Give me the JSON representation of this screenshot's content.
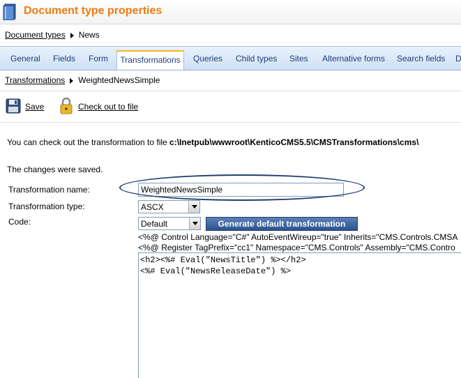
{
  "header": {
    "title": "Document type properties"
  },
  "breadcrumb_top": {
    "link": "Document types",
    "current": "News"
  },
  "tabs": [
    {
      "label": "General"
    },
    {
      "label": "Fields"
    },
    {
      "label": "Form"
    },
    {
      "label": "Transformations",
      "active": true
    },
    {
      "label": "Queries"
    },
    {
      "label": "Child types"
    },
    {
      "label": "Sites"
    },
    {
      "label": "Alternative forms"
    },
    {
      "label": "Search fields"
    },
    {
      "label": "D"
    }
  ],
  "breadcrumb_sub": {
    "link": "Transformations",
    "current": "WeightedNewsSimple"
  },
  "toolbar": {
    "save_label": "Save",
    "checkout_label": "Check out to file"
  },
  "info": {
    "prefix": "You can check out the transformation to file ",
    "path": "c:\\Inetpub\\wwwroot\\KenticoCMS5.5\\CMSTransformations\\cms\\"
  },
  "status": {
    "saved": "The changes were saved."
  },
  "form": {
    "name_label": "Transformation name:",
    "name_value": "WeightedNewsSimple",
    "type_label": "Transformation type:",
    "type_value": "ASCX",
    "code_label": "Code:",
    "code_select_value": "Default",
    "generate_button": "Generate default transformation",
    "directive1": "<%@ Control Language=\"C#\" AutoEventWireup=\"true\" Inherits=\"CMS.Controls.CMSA",
    "directive2": "<%@ Register TagPrefix=\"cc1\" Namespace=\"CMS.Controls\" Assembly=\"CMS.Contro",
    "code_lines": [
      "<h2><%# Eval(\"NewsTitle\") %></h2>",
      "<%# Eval(\"NewsReleaseDate\") %>"
    ]
  },
  "colors": {
    "title_orange": "#f07a0e",
    "tab_blue": "#cfe1f5",
    "tab_active_border": "#f7b524",
    "annotation_navy": "#1f3d6e"
  }
}
